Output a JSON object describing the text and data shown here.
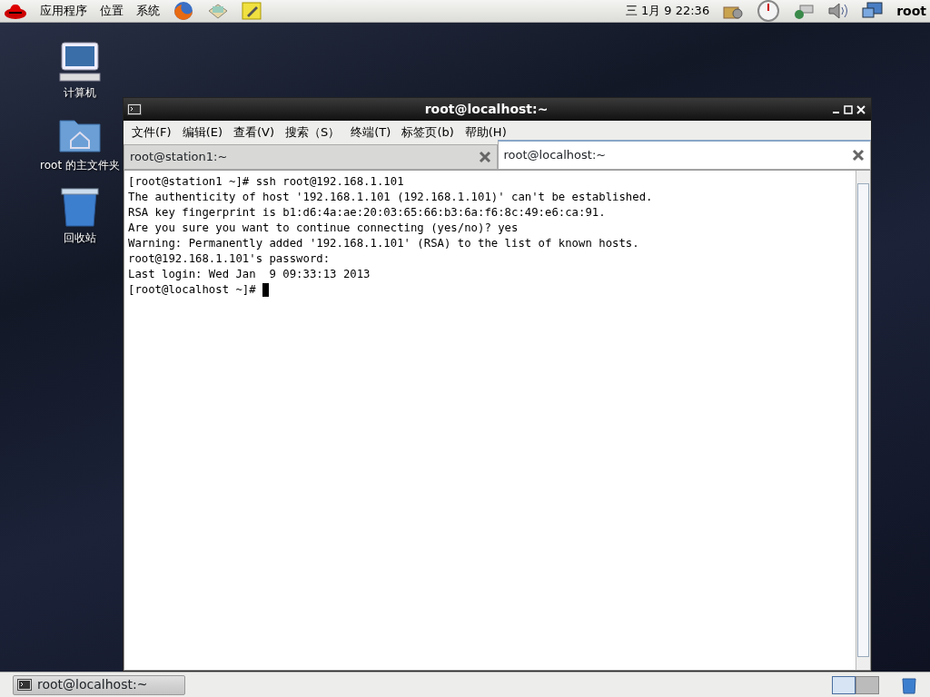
{
  "top_panel": {
    "menus": [
      "应用程序",
      "位置",
      "系统"
    ],
    "clock": "三  1月  9 22:36",
    "user": "root"
  },
  "desktop_icons": [
    {
      "kind": "computer",
      "label": "计算机"
    },
    {
      "kind": "home",
      "label": "root 的主文件夹"
    },
    {
      "kind": "trash",
      "label": "回收站"
    }
  ],
  "window": {
    "title": "root@localhost:~",
    "menu": [
      "文件(F)",
      "编辑(E)",
      "查看(V)",
      "搜索（S）",
      "终端(T)",
      "标签页(b)",
      "帮助(H)"
    ],
    "tabs": [
      {
        "label": "root@station1:~",
        "selected": false
      },
      {
        "label": "root@localhost:~",
        "selected": true
      }
    ],
    "terminal_lines": [
      "[root@station1 ~]# ssh root@192.168.1.101",
      "The authenticity of host '192.168.1.101 (192.168.1.101)' can't be established.",
      "RSA key fingerprint is b1:d6:4a:ae:20:03:65:66:b3:6a:f6:8c:49:e6:ca:91.",
      "Are you sure you want to continue connecting (yes/no)? yes",
      "Warning: Permanently added '192.168.1.101' (RSA) to the list of known hosts.",
      "root@192.168.1.101's password: ",
      "Last login: Wed Jan  9 09:33:13 2013",
      "[root@localhost ~]# "
    ]
  },
  "taskbar": {
    "tasks": [
      {
        "label": "root@localhost:~",
        "selected": true
      }
    ],
    "workspaces": [
      {
        "selected": true
      },
      {
        "selected": false
      }
    ]
  }
}
